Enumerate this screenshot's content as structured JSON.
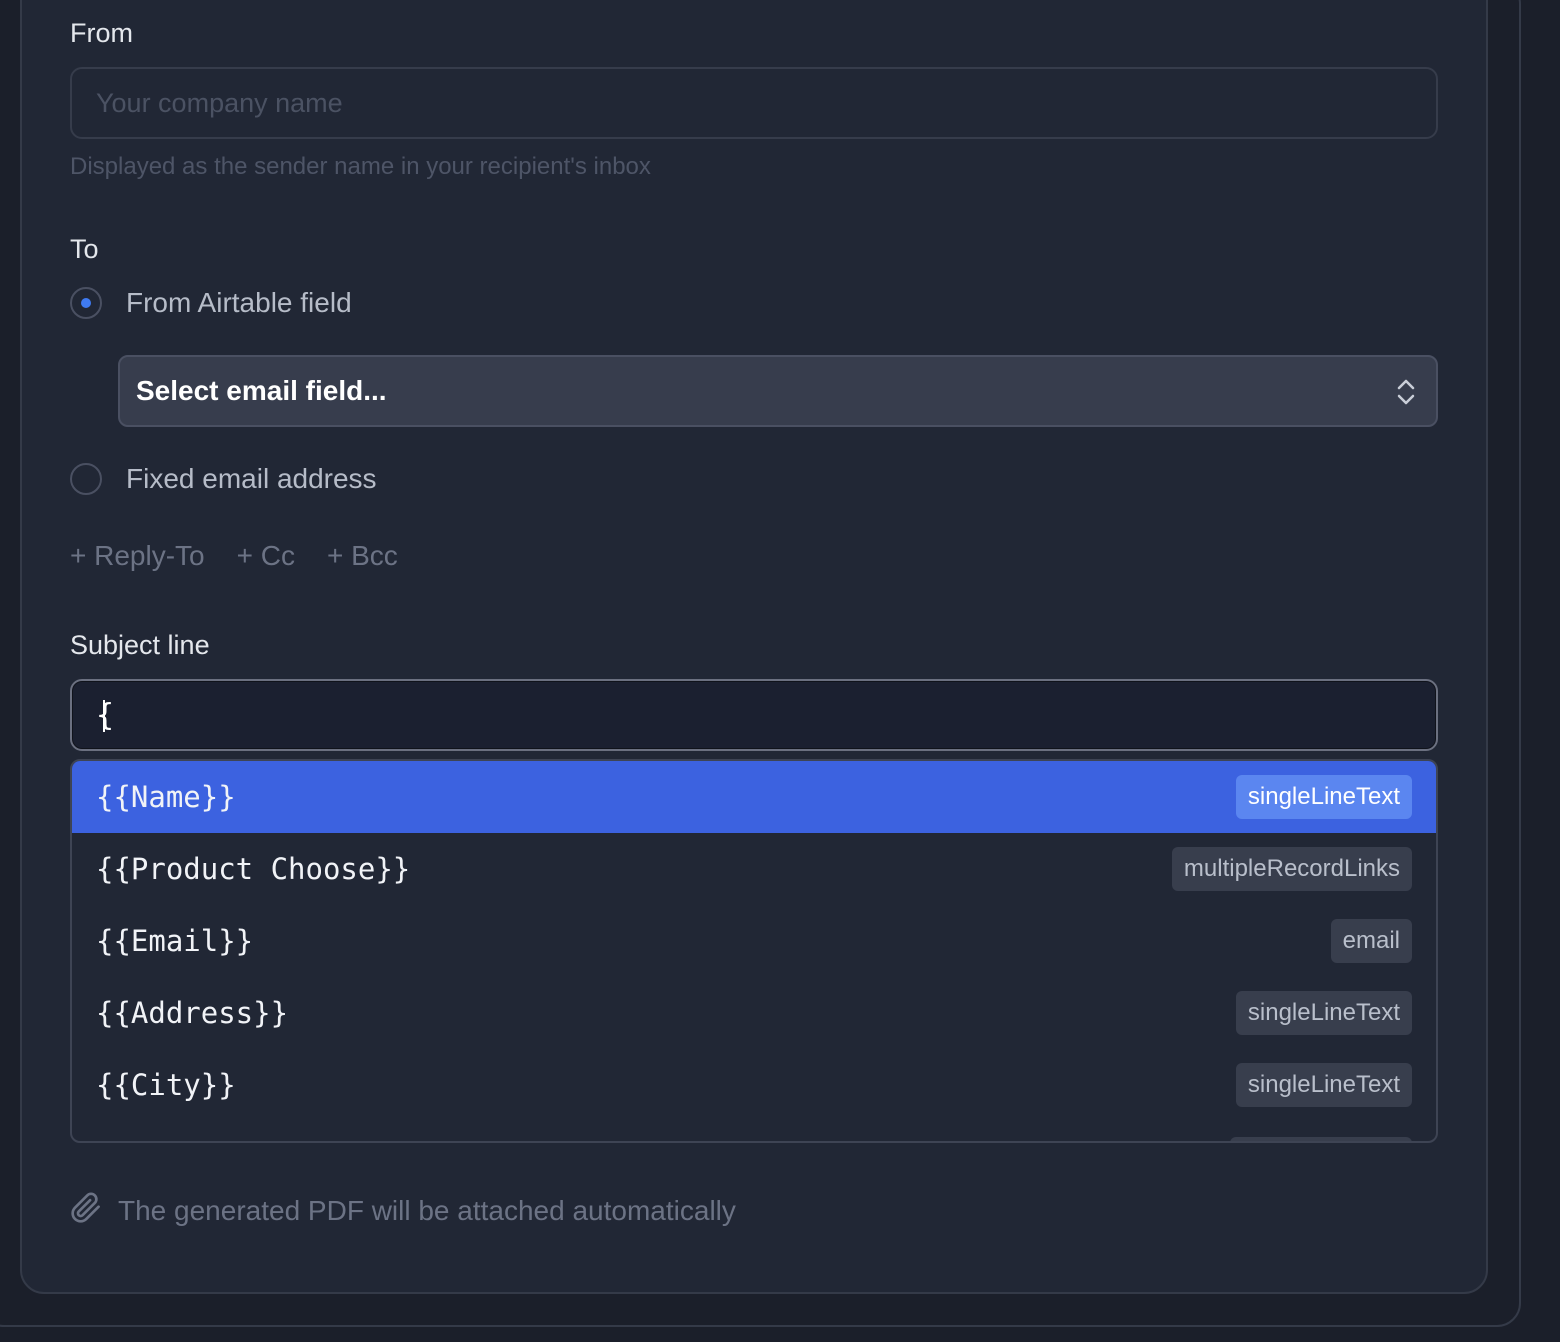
{
  "from": {
    "label": "From",
    "placeholder": "Your company name",
    "helper": "Displayed as the sender name in your recipient's inbox"
  },
  "to": {
    "label": "To",
    "option_airtable": "From Airtable field",
    "select_placeholder": "Select email field...",
    "option_fixed": "Fixed email address"
  },
  "extras": {
    "reply_to": "+ Reply-To",
    "cc": "+ Cc",
    "bcc": "+ Bcc"
  },
  "subject": {
    "label": "Subject line",
    "value": "{"
  },
  "suggestions": [
    {
      "name": "{{Name}}",
      "type": "singleLineText",
      "active": true
    },
    {
      "name": "{{Product Choose}}",
      "type": "multipleRecordLinks",
      "active": false
    },
    {
      "name": "{{Email}}",
      "type": "email",
      "active": false
    },
    {
      "name": "{{Address}}",
      "type": "singleLineText",
      "active": false
    },
    {
      "name": "{{City}}",
      "type": "singleLineText",
      "active": false
    }
  ],
  "attachment_note": "The generated PDF will be attached automatically",
  "colors": {
    "accent": "#3c62e0",
    "radio_dot": "#3f7bf2",
    "background": "#212735"
  },
  "icons": [
    "chevron-updown-icon",
    "paperclip-icon"
  ]
}
